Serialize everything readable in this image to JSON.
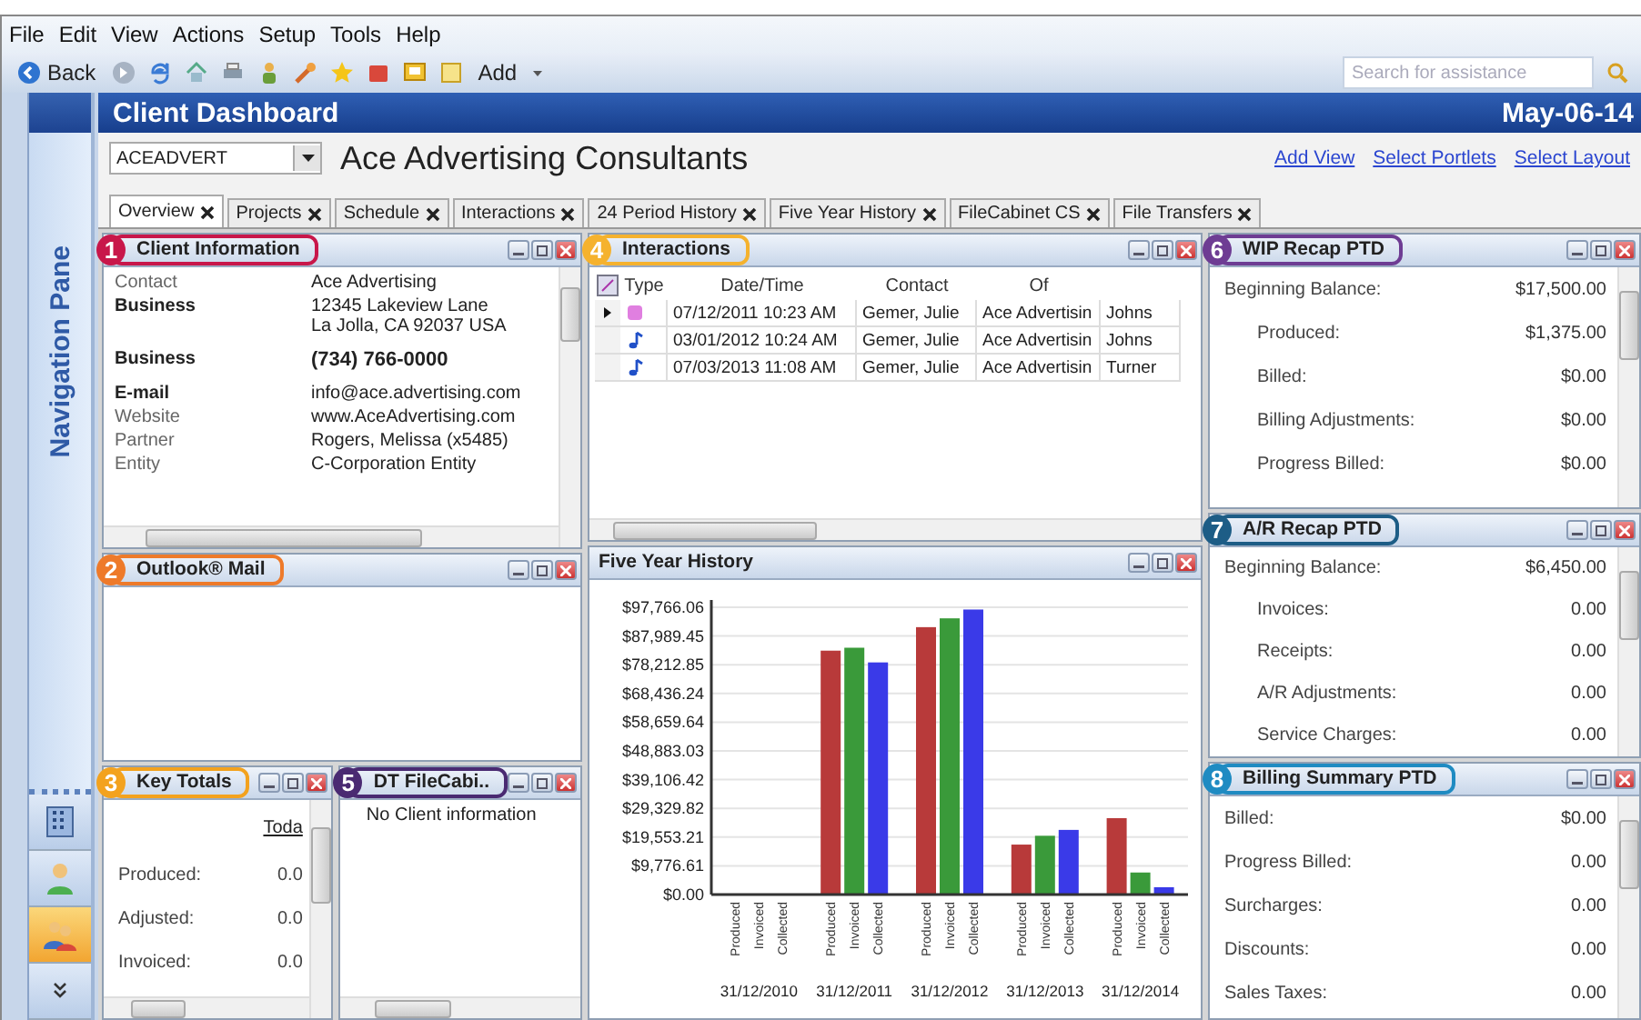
{
  "menu": [
    "File",
    "Edit",
    "View",
    "Actions",
    "Setup",
    "Tools",
    "Help"
  ],
  "toolbar": {
    "back": "Back",
    "add": "Add",
    "search": {
      "placeholder": "Search for assistance"
    }
  },
  "navigation_pane": {
    "title": "Navigation Pane"
  },
  "dashboard": {
    "title": "Client Dashboard",
    "date": "May-06-14"
  },
  "client": {
    "code": "ACEADVERT",
    "name": "Ace Advertising Consultants",
    "links": [
      "Add View",
      "Select Portlets",
      "Select Layout"
    ]
  },
  "tabs": [
    {
      "label": "Overview",
      "selected": true
    },
    {
      "label": "Projects",
      "selected": false
    },
    {
      "label": "Schedule",
      "selected": false
    },
    {
      "label": "Interactions",
      "selected": false
    },
    {
      "label": "24 Period History",
      "selected": false
    },
    {
      "label": "Five Year History",
      "selected": false
    },
    {
      "label": "FileCabinet CS",
      "selected": false
    },
    {
      "label": "File Transfers",
      "selected": false
    }
  ],
  "client_information": {
    "title": "Client Information",
    "callout": {
      "number": "1",
      "color": "#c8174a"
    },
    "rows": [
      {
        "label": "Contact",
        "value": "Ace Advertising",
        "label_bold": false,
        "value_bold": false
      },
      {
        "label": "Business",
        "value": "12345 Lakeview Lane\nLa Jolla, CA 92037 USA",
        "label_bold": true,
        "value_bold": false
      },
      {
        "label": "Business",
        "value": "(734) 766-0000",
        "label_bold": true,
        "value_bold": true
      },
      {
        "label": "E-mail",
        "value": "info@ace.advertising.com",
        "label_bold": true,
        "value_bold": false
      },
      {
        "label": "Website",
        "value": "www.AceAdvertising.com",
        "label_bold": false,
        "value_bold": false
      },
      {
        "label": "Partner",
        "value": "Rogers, Melissa (x5485)",
        "label_bold": false,
        "value_bold": false
      },
      {
        "label": "Entity",
        "value": "C-Corporation Entity",
        "label_bold": false,
        "value_bold": false
      }
    ]
  },
  "outlook_mail": {
    "title": "Outlook® Mail",
    "callout": {
      "number": "2",
      "color": "#ee7a2a"
    }
  },
  "key_totals": {
    "title": "Key Totals",
    "callout": {
      "number": "3",
      "color": "#f3a21e"
    },
    "column": "Toda",
    "rows": [
      {
        "label": "Produced:",
        "value": "0.0"
      },
      {
        "label": "Adjusted:",
        "value": "0.0"
      },
      {
        "label": "Invoiced:",
        "value": "0.0"
      }
    ]
  },
  "filecabinet": {
    "title": "DT FileCabi..",
    "callout": {
      "number": "5",
      "color": "#4a2a72"
    },
    "message": "No Client information"
  },
  "interactions": {
    "title": "Interactions",
    "callout": {
      "number": "4",
      "color": "#f5b22e"
    },
    "columns": [
      "Type",
      "Date/Time",
      "Contact",
      "Of"
    ],
    "rows": [
      {
        "selected": true,
        "kind": "memo",
        "date": "07/12/2011 10:23 AM",
        "contact": "Gemer, Julie",
        "of": "Ace Advertisin",
        "column_5": "Johns"
      },
      {
        "selected": false,
        "kind": "audio",
        "date": "03/01/2012 10:24 AM",
        "contact": "Gemer, Julie",
        "of": "Ace Advertisin",
        "column_5": "Johns"
      },
      {
        "selected": false,
        "kind": "audio",
        "date": "07/03/2013 11:08 AM",
        "contact": "Gemer, Julie",
        "of": "Ace Advertisin",
        "column_5": "Turner"
      }
    ]
  },
  "five_year_history": {
    "title": "Five Year History",
    "chart_data": {
      "type": "bar",
      "grid": true,
      "categories": [
        "31/12/2010",
        "31/12/2011",
        "31/12/2012",
        "31/12/2013",
        "31/12/2014"
      ],
      "series": [
        {
          "name": "Produced",
          "color": "#b83a3a",
          "values": [
            0,
            83000,
            91000,
            17000,
            26000
          ]
        },
        {
          "name": "Invoiced",
          "color": "#3a9a3a",
          "values": [
            0,
            84000,
            94000,
            20000,
            7500
          ]
        },
        {
          "name": "Collected",
          "color": "#3a3ae8",
          "values": [
            0,
            79000,
            97000,
            22000,
            2500
          ]
        }
      ],
      "ylim": [
        0,
        97766.06
      ],
      "yticks": [
        {
          "value": 0,
          "label": "$0.00"
        },
        {
          "value": 9776.61,
          "label": "$9,776.61"
        },
        {
          "value": 19553.21,
          "label": "$19,553.21"
        },
        {
          "value": 29329.82,
          "label": "$29,329.82"
        },
        {
          "value": 39106.42,
          "label": "$39,106.42"
        },
        {
          "value": 48883.03,
          "label": "$48,883.03"
        },
        {
          "value": 58659.64,
          "label": "$58,659.64"
        },
        {
          "value": 68436.24,
          "label": "$68,436.24"
        },
        {
          "value": 78212.85,
          "label": "$78,212.85"
        },
        {
          "value": 87989.45,
          "label": "$87,989.45"
        },
        {
          "value": 97766.06,
          "label": "$97,766.06"
        }
      ]
    }
  },
  "wip_recap": {
    "title": "WIP Recap PTD",
    "callout": {
      "number": "6",
      "color": "#6e3c93"
    },
    "rows": [
      {
        "label": "Beginning Balance:",
        "value": "$17,500.00",
        "children": [
          {
            "label": "Produced:",
            "value": "$1,375.00"
          },
          {
            "label": "Billed:",
            "value": "$0.00"
          },
          {
            "label": "Billing Adjustments:",
            "value": "$0.00"
          },
          {
            "label": "Progress Billed:",
            "value": "$0.00"
          }
        ]
      }
    ]
  },
  "ar_recap": {
    "title": "A/R Recap PTD",
    "callout": {
      "number": "7",
      "color": "#1d5d86"
    },
    "rows": [
      {
        "label": "Beginning Balance:",
        "value": "$6,450.00",
        "children": [
          {
            "label": "Invoices:",
            "value": "0.00"
          },
          {
            "label": "Receipts:",
            "value": "0.00"
          },
          {
            "label": "A/R Adjustments:",
            "value": "0.00"
          },
          {
            "label": "Service Charges:",
            "value": "0.00"
          }
        ]
      }
    ]
  },
  "billing_summary": {
    "title": "Billing Summary PTD",
    "callout": {
      "number": "8",
      "color": "#1f8bc2"
    },
    "rows": [
      {
        "label": "Billed:",
        "value": "$0.00"
      },
      {
        "label": "Progress Billed:",
        "value": "0.00"
      },
      {
        "label": "Surcharges:",
        "value": "0.00"
      },
      {
        "label": "Discounts:",
        "value": "0.00"
      },
      {
        "label": "Sales Taxes:",
        "value": "0.00"
      }
    ]
  }
}
